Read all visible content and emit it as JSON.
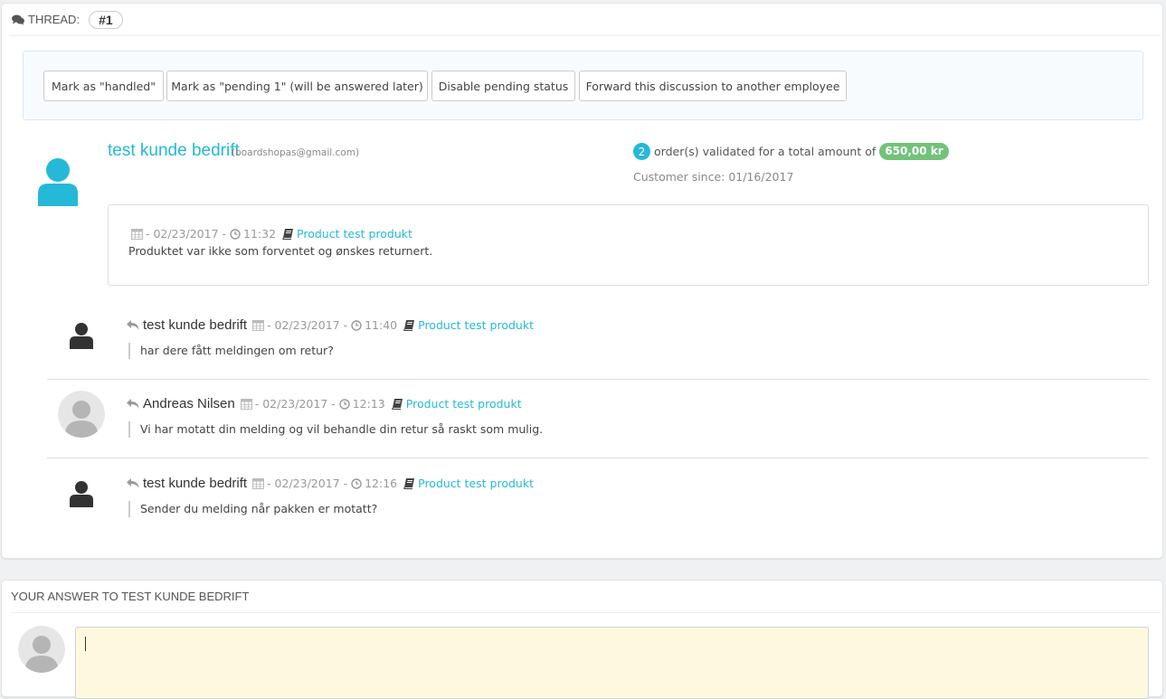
{
  "thread": {
    "label": "THREAD:",
    "number": "#1"
  },
  "actions": {
    "mark_handled": "Mark as \"handled\"",
    "mark_pending": "Mark as \"pending 1\" (will be answered later)",
    "disable_pending": "Disable pending status",
    "forward": "Forward this discussion to another employee"
  },
  "customer": {
    "name": "test kunde bedrift",
    "email": "(boardshopas@gmail.com)",
    "orders_count": "2",
    "orders_text": "order(s) validated for a total amount of",
    "total_amount": "650,00 kr",
    "since": "Customer since: 01/16/2017"
  },
  "first_message": {
    "date": "- 02/23/2017 -",
    "time": "11:32",
    "product": "Product test produkt",
    "text": "Produktet var ikke som forventet og ønskes returnert."
  },
  "replies": [
    {
      "author": "test kunde bedrift",
      "date": "- 02/23/2017 -",
      "time": "11:40",
      "product": "Product test produkt",
      "text": "har dere fått meldingen om retur?"
    },
    {
      "author": "Andreas Nilsen",
      "date": "- 02/23/2017 -",
      "time": "12:13",
      "product": "Product test produkt",
      "text": "Vi har motatt din melding og vil behandle din retur så raskt som mulig."
    },
    {
      "author": "test kunde bedrift",
      "date": "- 02/23/2017 -",
      "time": "12:16",
      "product": "Product test produkt",
      "text": "Sender du melding når pakken er motatt?"
    }
  ],
  "answer": {
    "heading": "YOUR ANSWER TO TEST KUNDE BEDRIFT",
    "value": ""
  },
  "colors": {
    "accent": "#25b9d7",
    "success": "#72c279",
    "answer_bg": "#fef8de"
  }
}
